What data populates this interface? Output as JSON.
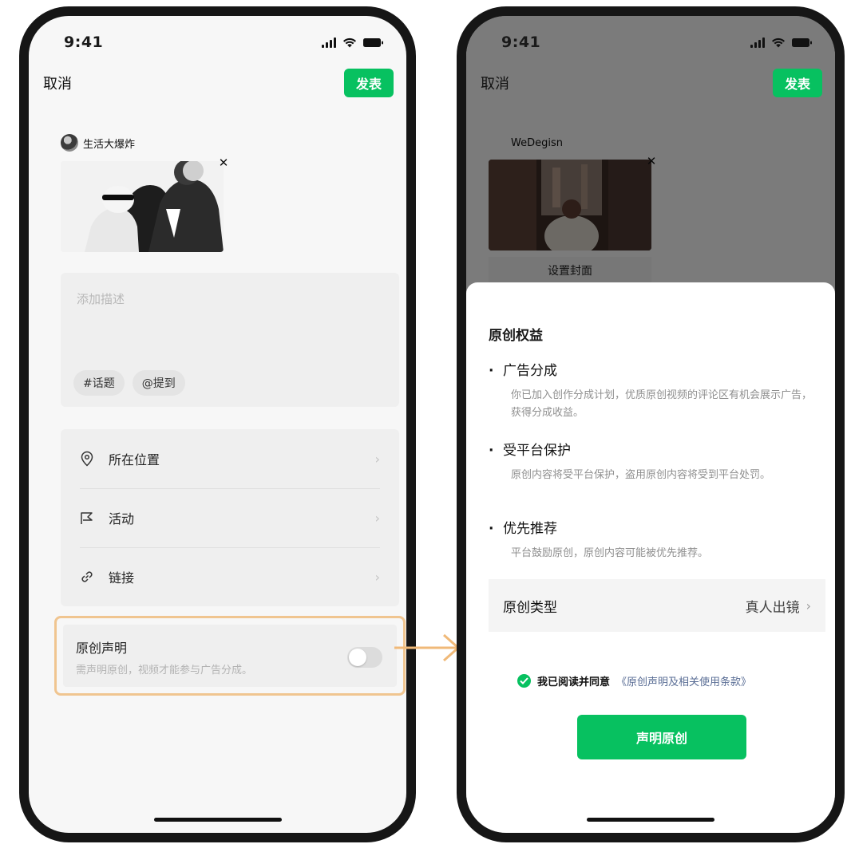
{
  "left_screen": {
    "status": {
      "time": "9:41"
    },
    "nav": {
      "cancel": "取消",
      "publish": "发表"
    },
    "author": {
      "name": "生活大爆炸"
    },
    "description": {
      "placeholder": "添加描述",
      "tags": [
        "#话题",
        "@提到"
      ]
    },
    "options": [
      {
        "label": "所在位置",
        "icon": "location-pin-icon"
      },
      {
        "label": "活动",
        "icon": "flag-icon"
      },
      {
        "label": "链接",
        "icon": "link-icon"
      }
    ],
    "original_declaration": {
      "title": "原创声明",
      "subtitle": "需声明原创，视频才能参与广告分成。",
      "toggle_on": false,
      "highlight_color": "#f0c590"
    }
  },
  "right_screen": {
    "status": {
      "time": "9:41"
    },
    "nav": {
      "cancel": "取消",
      "publish": "发表"
    },
    "author": {
      "name": "WeDegisn"
    },
    "cover_label": "设置封面",
    "sheet": {
      "title": "原创权益",
      "items": [
        {
          "title": "广告分成",
          "body": "你已加入创作分成计划，优质原创视频的评论区有机会展示广告，获得分成收益。"
        },
        {
          "title": "受平台保护",
          "body": "原创内容将受平台保护，盗用原创内容将受到平台处罚。"
        },
        {
          "title": "优先推荐",
          "body": "平台鼓励原创，原创内容可能被优先推荐。"
        }
      ],
      "type_row": {
        "label": "原创类型",
        "value": "真人出镜"
      },
      "agreement": {
        "text": "我已阅读并同意",
        "link": "《原创声明及相关使用条款》",
        "checked": true
      },
      "button": "声明原创"
    }
  },
  "colors": {
    "brand_green": "#07c160",
    "link": "#586c94",
    "arrow": "#f0b978"
  }
}
